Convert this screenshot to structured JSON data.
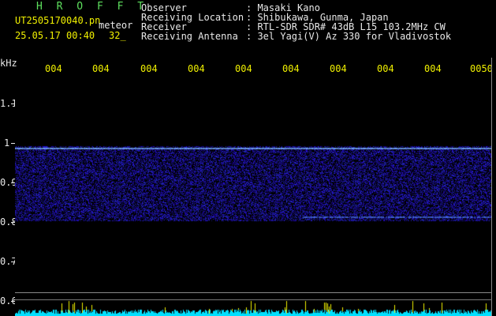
{
  "header": {
    "title": "H R O F F T",
    "filename": "UT2505170040.pn",
    "mode": "meteor",
    "datetime": "25.05.17 00:40",
    "count": "32_",
    "fields": [
      {
        "label": "Observer",
        "value": ": Masaki Kano"
      },
      {
        "label": "Receiving Location",
        "value": ": Shibukawa, Gunma, Japan"
      },
      {
        "label": "Receiver",
        "value": ": RTL-SDR SDR# 43dB L15 103.2MHz CW"
      },
      {
        "label": "Receiving Antenna",
        "value": ": 3el Yagi(V) Az 330 for Vladivostok"
      }
    ]
  },
  "axis": {
    "unit": "kHz",
    "y_ticks": [
      "1.1",
      "1",
      "0.9",
      "0.8",
      "0.7",
      "0.6"
    ],
    "x_ticks": [
      "004",
      "004",
      "004",
      "004",
      "004",
      "004",
      "004",
      "004",
      "004",
      "0050"
    ]
  },
  "colors": {
    "background": "#000000",
    "signal": "#2a46ff",
    "carrier": "#6ea0ff",
    "noise_bar": "#00e0ff",
    "spike": "#f0f000",
    "text_title": "#5ee05e",
    "text_label": "#e8e8e8",
    "text_tick": "#f0f000"
  }
}
